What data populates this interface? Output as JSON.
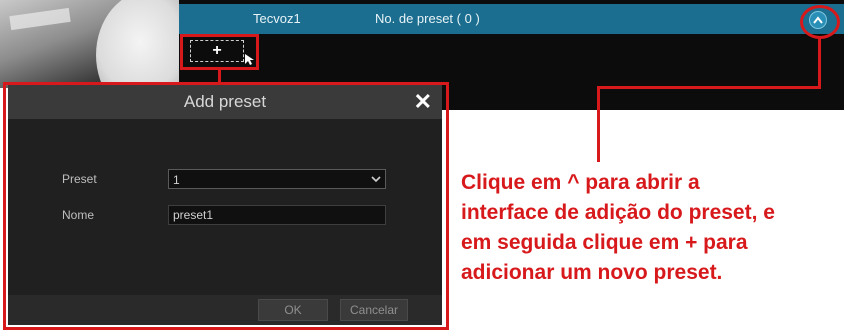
{
  "panel": {
    "channel_name": "Tecvoz1",
    "preset_count_label": "No. de preset ( 0 )",
    "expand_glyph": "^",
    "add_glyph": "+",
    "expand_icon": "chevron-up-icon",
    "add_icon": "plus-icon"
  },
  "dialog": {
    "title": "Add preset",
    "close_glyph": "✕",
    "preset_label": "Preset",
    "preset_value": "1",
    "name_label": "Nome",
    "name_value": "preset1",
    "ok_label": "OK",
    "cancel_label": "Cancelar"
  },
  "annotation": {
    "lines": [
      "Clique em ^ para abrir a",
      "interface de adição do preset, e",
      "em seguida clique em + para",
      "adicionar um novo preset."
    ],
    "color": "#d7191c"
  },
  "colors": {
    "header_blue": "#1b6e8f",
    "panel_bg": "#0c0c0c",
    "dialog_bg": "#202020"
  }
}
